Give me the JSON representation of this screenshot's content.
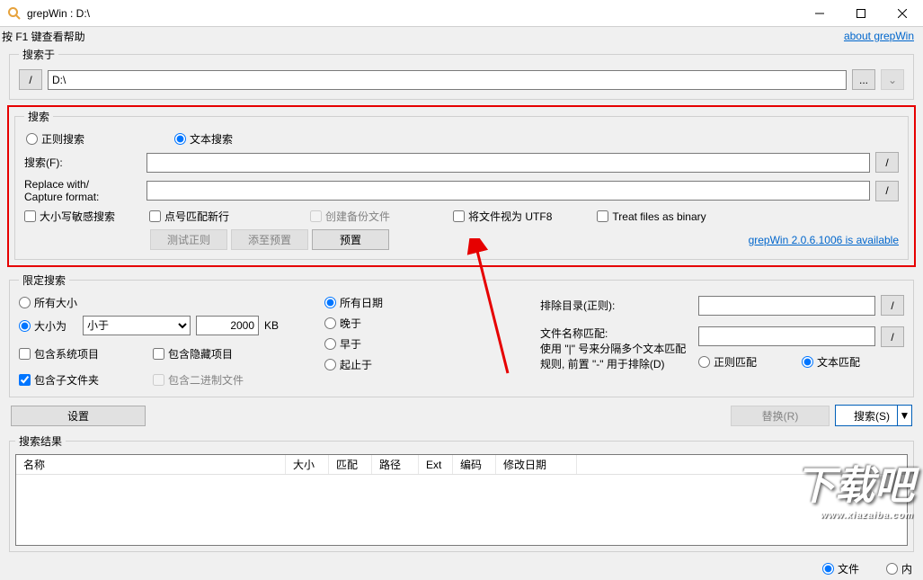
{
  "titlebar": {
    "title": "grepWin : D:\\"
  },
  "helpbar": {
    "help_text": "按 F1 键查看帮助",
    "about_link": "about grepWin"
  },
  "search_in": {
    "legend": "搜索于",
    "slash_btn": "/",
    "path_value": "D:\\",
    "browse_btn": "...",
    "mru_btn": "⌄"
  },
  "search": {
    "legend": "搜索",
    "mode_regex": "正则搜索",
    "mode_text": "文本搜索",
    "search_label": "搜索(F):",
    "replace_label_line1": "Replace with/",
    "replace_label_line2": "Capture format:",
    "slash_btn": "/",
    "case_sensitive": "大小写敏感搜索",
    "dot_newline": "点号匹配新行",
    "create_backup": "创建备份文件",
    "treat_utf8": "将文件视为 UTF8",
    "treat_binary": "Treat files as binary",
    "test_regex_btn": "测试正则",
    "add_preset_btn": "添至预置",
    "presets_btn": "预置",
    "update_link": "grepWin 2.0.6.1006 is available"
  },
  "limit": {
    "legend": "限定搜索",
    "size_all": "所有大小",
    "size_is": "大小为",
    "size_op_value": "小于",
    "size_value": "2000",
    "size_unit": "KB",
    "include_system": "包含系统项目",
    "include_hidden": "包含隐藏项目",
    "include_subdirs": "包含子文件夹",
    "include_binary": "包含二进制文件",
    "date_all": "所有日期",
    "date_newer": "晚于",
    "date_older": "早于",
    "date_between": "起止于",
    "exclude_dirs_label": "排除目录(正则):",
    "filename_match_label": "文件名称匹配:",
    "filename_hint_line1": "使用 \"|\" 号来分隔多个文本匹配",
    "filename_hint_line2": "规则, 前置 \"-\" 用于排除(D)",
    "match_regex": "正则匹配",
    "match_text": "文本匹配",
    "slash_btn": "/"
  },
  "actions": {
    "settings_btn": "设置",
    "replace_btn": "替换(R)",
    "search_btn": "搜索(S)"
  },
  "results": {
    "legend": "搜索结果",
    "columns": {
      "name": "名称",
      "size": "大小",
      "matches": "匹配",
      "path": "路径",
      "ext": "Ext",
      "encoding": "编码",
      "date": "修改日期"
    }
  },
  "bottom": {
    "opt_files": "文件",
    "opt_content": "内"
  },
  "watermark": {
    "text": "下载吧",
    "url": "www.xiazaiba.com"
  }
}
